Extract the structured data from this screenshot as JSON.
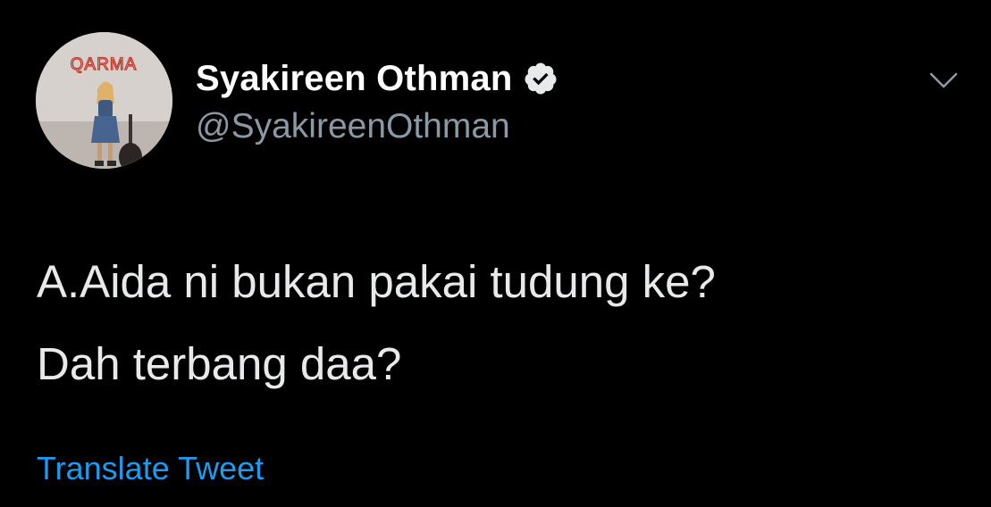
{
  "user": {
    "display_name": "Syakireen Othman",
    "handle": "@SyakireenOthman",
    "verified_icon": "verified-badge-icon",
    "avatar_sign_text": "QARMA"
  },
  "header": {
    "menu_icon": "chevron-down-icon"
  },
  "tweet": {
    "lines": [
      "A.Aida ni bukan pakai tudung ke?",
      "Dah terbang daa?"
    ]
  },
  "actions": {
    "translate_label": "Translate Tweet"
  },
  "colors": {
    "background": "#000000",
    "primary_text": "#e7e9ea",
    "secondary_text": "#8b98a5",
    "link": "#1d9bf0",
    "avatar_sign": "#c0392b"
  }
}
